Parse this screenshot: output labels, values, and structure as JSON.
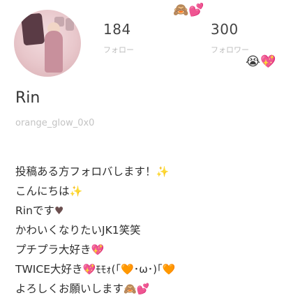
{
  "profile": {
    "name": "Rin",
    "username": "orange_glow_0x0"
  },
  "stats": {
    "following_count": "184",
    "following_label": "フォロー",
    "followers_count": "300",
    "followers_label": "フォロワー"
  },
  "decorations": {
    "top_emoji": "🙈💕",
    "side_emoji": "😭💖"
  },
  "bio": {
    "lines": [
      {
        "text": "投稿ある方フォロバします！",
        "emoji": "✨"
      },
      {
        "text": "こんにちは",
        "emoji": "✨"
      },
      {
        "text": "Rinです",
        "emoji": "♥"
      },
      {
        "text": "かわいくなりたいJK1笑笑",
        "emoji": ""
      },
      {
        "text": "プチプラ大好き",
        "emoji": "💖"
      },
      {
        "text": "TWICE大好き",
        "emoji": "💖ﾓﾓｫ(｢🧡･ω･)｢🧡"
      },
      {
        "text": "よろしくお願いします",
        "emoji": "🙈💕"
      }
    ]
  }
}
